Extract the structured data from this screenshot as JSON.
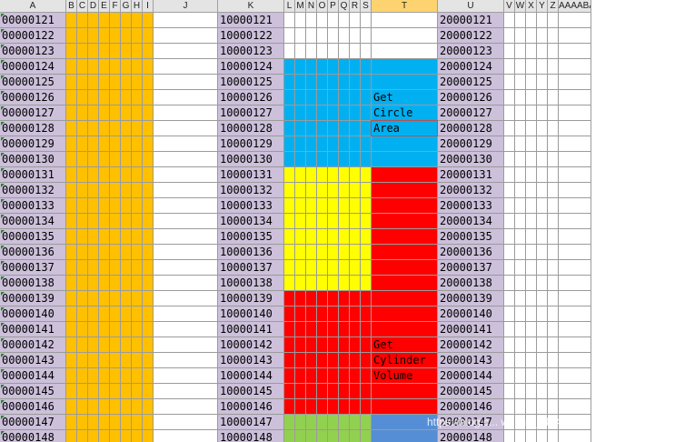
{
  "column_headers": [
    "A",
    "B",
    "C",
    "D",
    "E",
    "F",
    "G",
    "H",
    "I",
    "J",
    "K",
    "L",
    "M",
    "N",
    "O",
    "P",
    "Q",
    "R",
    "S",
    "T",
    "U",
    "V",
    "W",
    "X",
    "Y",
    "Z",
    "AAAABAC"
  ],
  "selected_column": "T",
  "column_a_values": [
    "00000121",
    "00000122",
    "00000123",
    "00000124",
    "00000125",
    "00000126",
    "00000127",
    "00000128",
    "00000129",
    "00000130",
    "00000131",
    "00000132",
    "00000133",
    "00000134",
    "00000135",
    "00000136",
    "00000137",
    "00000138",
    "00000139",
    "00000140",
    "00000141",
    "00000142",
    "00000143",
    "00000144",
    "00000145",
    "00000146",
    "00000147",
    "00000148"
  ],
  "column_k_values": [
    "10000121",
    "10000122",
    "10000123",
    "10000124",
    "10000125",
    "10000126",
    "10000127",
    "10000128",
    "10000129",
    "10000130",
    "10000131",
    "10000132",
    "10000133",
    "10000134",
    "10000135",
    "10000136",
    "10000137",
    "10000138",
    "10000139",
    "10000140",
    "10000141",
    "10000142",
    "10000143",
    "10000144",
    "10000145",
    "10000146",
    "10000147",
    "10000148"
  ],
  "column_u_values": [
    "20000121",
    "20000122",
    "20000123",
    "20000124",
    "20000125",
    "20000126",
    "20000127",
    "20000128",
    "20000129",
    "20000130",
    "20000131",
    "20000132",
    "20000133",
    "20000134",
    "20000135",
    "20000136",
    "20000137",
    "20000138",
    "20000139",
    "20000140",
    "20000141",
    "20000142",
    "20000143",
    "20000144",
    "20000145",
    "20000146",
    "20000147",
    "20000148"
  ],
  "comments": [
    {
      "row": 5,
      "text": "Get"
    },
    {
      "row": 6,
      "text": "Circle"
    },
    {
      "row": 7,
      "text": "Area"
    },
    {
      "row": 21,
      "text": "Get"
    },
    {
      "row": 22,
      "text": "Cylinder"
    },
    {
      "row": 23,
      "text": "Volume"
    }
  ],
  "colors": {
    "orange": "#ffc000",
    "lavender": "#ccc0da",
    "blue": "#00b0f0",
    "yellow": "#ffff00",
    "red": "#ff0000",
    "green": "#92d050",
    "steel_blue": "#558ed5"
  },
  "watermark": "https://blog.c... weixin_44841938"
}
